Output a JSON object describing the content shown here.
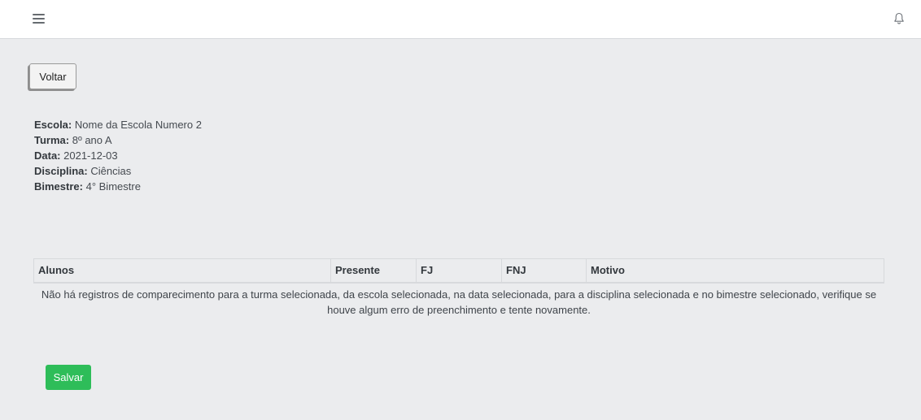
{
  "header": {
    "menu_icon": "hamburger-menu-icon",
    "notification_icon": "bell-icon"
  },
  "back_button": {
    "label": "Voltar"
  },
  "info": [
    {
      "label": "Escola:",
      "value": "Nome da Escola Numero 2"
    },
    {
      "label": "Turma:",
      "value": "8º ano A"
    },
    {
      "label": "Data:",
      "value": "2021-12-03"
    },
    {
      "label": "Disciplina:",
      "value": "Ciências"
    },
    {
      "label": "Bimestre:",
      "value": "4° Bimestre"
    }
  ],
  "table": {
    "columns": [
      "Alunos",
      "Presente",
      "FJ",
      "FNJ",
      "Motivo"
    ],
    "empty_message": "Não há registros de comparecimento para a turma selecionada, da escola selecionada, na data selecionada, para a disciplina selecionada e no bimestre selecionado, verifique se houve algum erro de preenchimento e tente novamente."
  },
  "save_button": {
    "label": "Salvar",
    "color": "#2ebd59"
  }
}
